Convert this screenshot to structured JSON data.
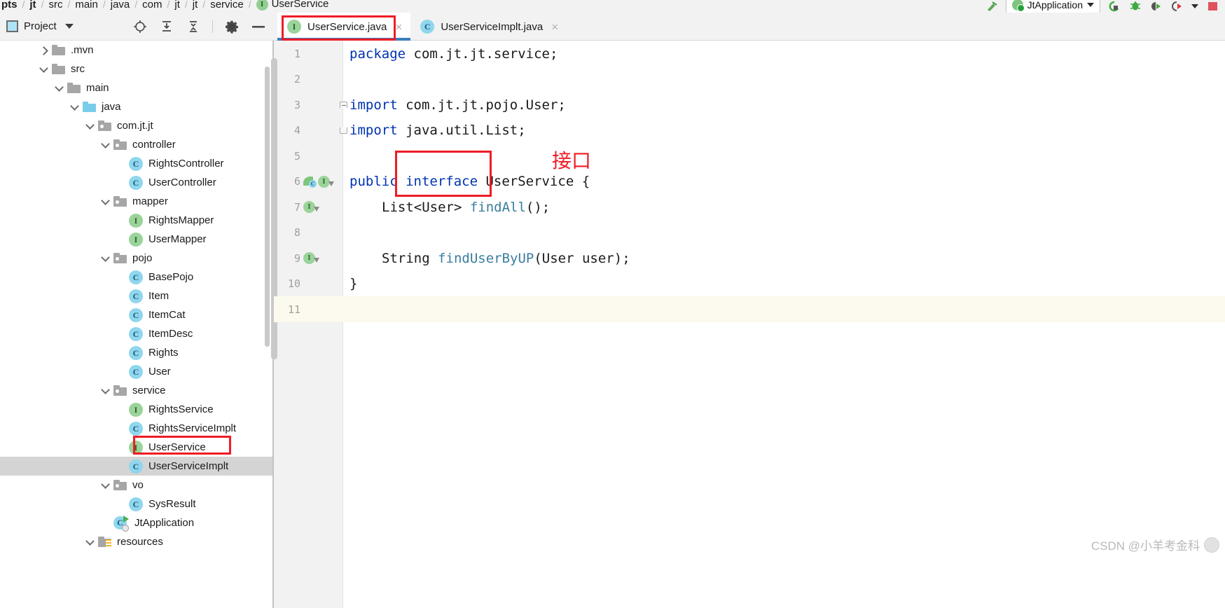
{
  "breadcrumb": {
    "items": [
      {
        "label": "pts",
        "bold": true,
        "icon": null
      },
      {
        "label": "jt",
        "bold": true,
        "icon": null
      },
      {
        "label": "src",
        "bold": false,
        "icon": null
      },
      {
        "label": "main",
        "bold": false,
        "icon": null
      },
      {
        "label": "java",
        "bold": false,
        "icon": null
      },
      {
        "label": "com",
        "bold": false,
        "icon": null
      },
      {
        "label": "jt",
        "bold": false,
        "icon": null
      },
      {
        "label": "jt",
        "bold": false,
        "icon": null
      },
      {
        "label": "service",
        "bold": false,
        "icon": null
      },
      {
        "label": "UserService",
        "bold": false,
        "icon": "interface-icon"
      }
    ],
    "separator": "/"
  },
  "top_toolbar": {
    "run_configuration": "JtApplication",
    "buttons": [
      "run-button",
      "debug-button",
      "run-with-coverage-button",
      "profile-button",
      "more-button",
      "stop-button"
    ]
  },
  "project_panel": {
    "title": "Project",
    "actions": [
      "locate-icon",
      "expand-all-icon",
      "collapse-all-icon",
      "settings-gear-icon",
      "hide-icon"
    ]
  },
  "tree": [
    {
      "label": ".mvn",
      "depth": 2,
      "twisty": "right",
      "icon": "folder",
      "selected": false
    },
    {
      "label": "src",
      "depth": 2,
      "twisty": "down",
      "icon": "folder",
      "selected": false
    },
    {
      "label": "main",
      "depth": 3,
      "twisty": "down",
      "icon": "folder",
      "selected": false
    },
    {
      "label": "java",
      "depth": 4,
      "twisty": "down",
      "icon": "folder-blue",
      "selected": false
    },
    {
      "label": "com.jt.jt",
      "depth": 5,
      "twisty": "down",
      "icon": "package",
      "selected": false
    },
    {
      "label": "controller",
      "depth": 6,
      "twisty": "down",
      "icon": "package",
      "selected": false
    },
    {
      "label": "RightsController",
      "depth": 7,
      "twisty": "none",
      "icon": "class",
      "selected": false
    },
    {
      "label": "UserController",
      "depth": 7,
      "twisty": "none",
      "icon": "class",
      "selected": false
    },
    {
      "label": "mapper",
      "depth": 6,
      "twisty": "down",
      "icon": "package",
      "selected": false
    },
    {
      "label": "RightsMapper",
      "depth": 7,
      "twisty": "none",
      "icon": "interface",
      "selected": false
    },
    {
      "label": "UserMapper",
      "depth": 7,
      "twisty": "none",
      "icon": "interface",
      "selected": false
    },
    {
      "label": "pojo",
      "depth": 6,
      "twisty": "down",
      "icon": "package",
      "selected": false
    },
    {
      "label": "BasePojo",
      "depth": 7,
      "twisty": "none",
      "icon": "class",
      "selected": false
    },
    {
      "label": "Item",
      "depth": 7,
      "twisty": "none",
      "icon": "class",
      "selected": false
    },
    {
      "label": "ItemCat",
      "depth": 7,
      "twisty": "none",
      "icon": "class",
      "selected": false
    },
    {
      "label": "ItemDesc",
      "depth": 7,
      "twisty": "none",
      "icon": "class",
      "selected": false
    },
    {
      "label": "Rights",
      "depth": 7,
      "twisty": "none",
      "icon": "class",
      "selected": false
    },
    {
      "label": "User",
      "depth": 7,
      "twisty": "none",
      "icon": "class",
      "selected": false
    },
    {
      "label": "service",
      "depth": 6,
      "twisty": "down",
      "icon": "package",
      "selected": false
    },
    {
      "label": "RightsService",
      "depth": 7,
      "twisty": "none",
      "icon": "interface",
      "selected": false
    },
    {
      "label": "RightsServiceImplt",
      "depth": 7,
      "twisty": "none",
      "icon": "class",
      "selected": false
    },
    {
      "label": "UserService",
      "depth": 7,
      "twisty": "none",
      "icon": "interface",
      "selected": false
    },
    {
      "label": "UserServiceImplt",
      "depth": 7,
      "twisty": "none",
      "icon": "class",
      "selected": true
    },
    {
      "label": "vo",
      "depth": 6,
      "twisty": "down",
      "icon": "package",
      "selected": false
    },
    {
      "label": "SysResult",
      "depth": 7,
      "twisty": "none",
      "icon": "class",
      "selected": false
    },
    {
      "label": "JtApplication",
      "depth": 6,
      "twisty": "none",
      "icon": "runnable",
      "selected": false
    },
    {
      "label": "resources",
      "depth": 5,
      "twisty": "down",
      "icon": "resources",
      "selected": false
    }
  ],
  "editor_tabs": [
    {
      "label": "UserService.java",
      "icon": "interface-icon",
      "active": true,
      "close": "×"
    },
    {
      "label": "UserServiceImplt.java",
      "icon": "class-icon",
      "active": false,
      "close": "×"
    }
  ],
  "code": {
    "lines": [
      {
        "num": "1",
        "indent": 0,
        "gutter": [],
        "fold": "none",
        "tokens": [
          {
            "t": "package ",
            "c": "kw"
          },
          {
            "t": "com.jt.jt.service;",
            "c": "plain"
          }
        ]
      },
      {
        "num": "2",
        "indent": 0,
        "gutter": [],
        "fold": "none",
        "tokens": []
      },
      {
        "num": "3",
        "indent": 0,
        "gutter": [],
        "fold": "top",
        "tokens": [
          {
            "t": "import ",
            "c": "kw"
          },
          {
            "t": "com.jt.jt.pojo.User;",
            "c": "plain"
          }
        ]
      },
      {
        "num": "4",
        "indent": 0,
        "gutter": [],
        "fold": "bot",
        "tokens": [
          {
            "t": "import ",
            "c": "kw"
          },
          {
            "t": "java.util.List;",
            "c": "plain"
          }
        ]
      },
      {
        "num": "5",
        "indent": 0,
        "gutter": [],
        "fold": "none",
        "tokens": []
      },
      {
        "num": "6",
        "indent": 0,
        "gutter": [
          "bean",
          "impl"
        ],
        "fold": "none",
        "tokens": [
          {
            "t": "public ",
            "c": "kw"
          },
          {
            "t": "interface ",
            "c": "kw"
          },
          {
            "t": "UserService {",
            "c": "plain"
          }
        ]
      },
      {
        "num": "7",
        "indent": 1,
        "gutter": [
          "impl"
        ],
        "fold": "none",
        "tokens": [
          {
            "t": "List<User> ",
            "c": "plain"
          },
          {
            "t": "findAll",
            "c": "meth"
          },
          {
            "t": "();",
            "c": "plain"
          }
        ]
      },
      {
        "num": "8",
        "indent": 0,
        "gutter": [],
        "fold": "none",
        "tokens": []
      },
      {
        "num": "9",
        "indent": 1,
        "gutter": [
          "impl"
        ],
        "fold": "none",
        "tokens": [
          {
            "t": "String ",
            "c": "plain"
          },
          {
            "t": "findUserByUP",
            "c": "meth"
          },
          {
            "t": "(User user);",
            "c": "plain"
          }
        ]
      },
      {
        "num": "10",
        "indent": 0,
        "gutter": [],
        "fold": "none",
        "tokens": [
          {
            "t": "}",
            "c": "plain"
          }
        ]
      },
      {
        "num": "11",
        "indent": 0,
        "gutter": [],
        "fold": "none",
        "highlight": true,
        "tokens": []
      }
    ]
  },
  "annotations": {
    "interface_label": "接口",
    "highlight_color": "#ee1c25"
  },
  "watermark": {
    "text": "CSDN @小羊考金科"
  }
}
